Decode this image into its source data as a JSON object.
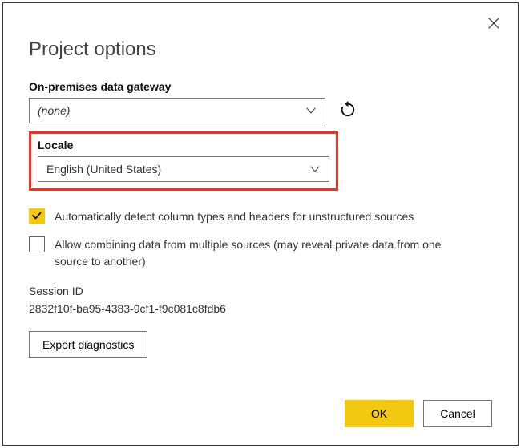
{
  "title": "Project options",
  "gateway": {
    "label": "On-premises data gateway",
    "value": "(none)"
  },
  "locale": {
    "label": "Locale",
    "value": "English (United States)"
  },
  "options": {
    "autoDetect": {
      "label": "Automatically detect column types and headers for unstructured sources",
      "checked": true
    },
    "allowCombine": {
      "label": "Allow combining data from multiple sources (may reveal private data from one source to another)",
      "checked": false
    }
  },
  "session": {
    "label": "Session ID",
    "id": "2832f10f-ba95-4383-9cf1-f9c081c8fdb6"
  },
  "buttons": {
    "export": "Export diagnostics",
    "ok": "OK",
    "cancel": "Cancel"
  }
}
